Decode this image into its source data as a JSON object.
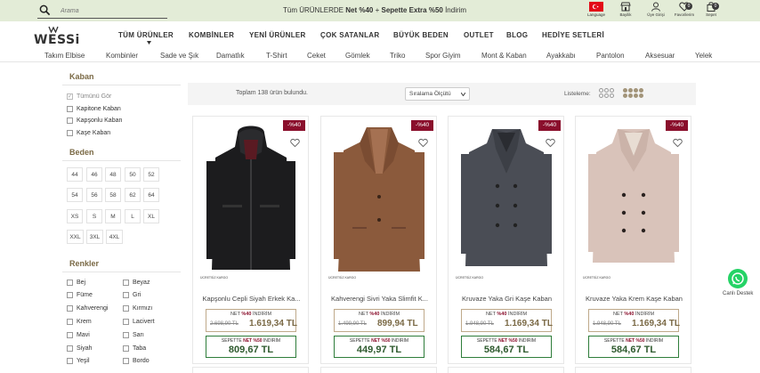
{
  "search": {
    "placeholder": "Arama"
  },
  "promo": {
    "prefix": "Tüm ÜRÜNLERDE ",
    "bold1": "Net %40",
    "middle": " + ",
    "bold2": "Sepette Extra %50",
    "suffix": " İndirim"
  },
  "utility": [
    {
      "label": "Language",
      "icon": "turkey-flag-icon"
    },
    {
      "label": "Bayilik",
      "icon": "store-icon"
    },
    {
      "label": "Üye Girişi",
      "icon": "user-icon"
    },
    {
      "label": "Favorilerim",
      "icon": "heart-icon",
      "badge": "0"
    },
    {
      "label": "Sepet",
      "icon": "bag-icon",
      "badge": "0"
    }
  ],
  "logo": {
    "text": "WESSi"
  },
  "main_nav": [
    "TÜM ÜRÜNLER",
    "KOMBİNLER",
    "YENİ ÜRÜNLER",
    "ÇOK SATANLAR",
    "BÜYÜK BEDEN",
    "OUTLET",
    "BLOG",
    "HEDİYE SETLERİ"
  ],
  "sub_nav": [
    "Takım Elbise",
    "Kombinler",
    "Sade ve Şık",
    "Damatlık",
    "T-Shirt",
    "Ceket",
    "Gömlek",
    "Triko",
    "Spor Giyim",
    "Mont & Kaban",
    "Ayakkabı",
    "Pantolon",
    "Aksesuar",
    "Yelek"
  ],
  "filters": {
    "kaban_title": "Kaban",
    "kaban": [
      "Tümünü Gör",
      "Kapitone Kaban",
      "Kapşonlu Kaban",
      "Kaşe Kaban"
    ],
    "beden_title": "Beden",
    "sizes": [
      "44",
      "46",
      "48",
      "50",
      "52",
      "54",
      "56",
      "58",
      "62",
      "64",
      "XS",
      "S",
      "M",
      "L",
      "XL",
      "XXL",
      "3XL",
      "4XL"
    ],
    "renk_title": "Renkler",
    "colors_left": [
      "Bej",
      "Füme",
      "Kahverengi",
      "Krem",
      "Mavi",
      "Siyah",
      "Yeşil"
    ],
    "colors_right": [
      "Beyaz",
      "Gri",
      "Kırmızı",
      "Lacivert",
      "Sarı",
      "Taba",
      "Bordo"
    ]
  },
  "toolbar": {
    "total": "Toplam 138 ürün bulundu.",
    "sort": "Sıralama Ölçütü",
    "list_label": "Listeleme:"
  },
  "products": [
    {
      "name": "Kapşonlu Cepli Siyah Erkek Ka...",
      "discount": "-%40",
      "shipping": "ÜCRETSİZ KARGO",
      "net_label": "NET",
      "net_pct": "%40",
      "net_suffix": "İNDİRİM",
      "old": "2.698,90 TL",
      "new": "1.619,34 TL",
      "cart_label": "SEPETTE",
      "cart_pct": "NET %50",
      "cart_suffix": "İNDİRİM",
      "final": "809,67 TL",
      "color": "#1c1c1e"
    },
    {
      "name": "Kahverengi Sivri Yaka Slimfit K...",
      "discount": "-%40",
      "shipping": "ÜCRETSİZ KARGO",
      "net_label": "NET",
      "net_pct": "%40",
      "net_suffix": "İNDİRİM",
      "old": "1.499,90 TL",
      "new": "899,94 TL",
      "cart_label": "SEPETTE",
      "cart_pct": "NET %50",
      "cart_suffix": "İNDİRİM",
      "final": "449,97 TL",
      "color": "#8b5a3c"
    },
    {
      "name": "Kruvaze Yaka Gri Kaşe Kaban",
      "discount": "-%40",
      "shipping": "ÜCRETSİZ KARGO",
      "net_label": "NET",
      "net_pct": "%40",
      "net_suffix": "İNDİRİM",
      "old": "1.948,90 TL",
      "new": "1.169,34 TL",
      "cart_label": "SEPETTE",
      "cart_pct": "NET %50",
      "cart_suffix": "İNDİRİM",
      "final": "584,67 TL",
      "color": "#4a4d55"
    },
    {
      "name": "Kruvaze Yaka Krem Kaşe Kaban",
      "discount": "-%40",
      "shipping": "ÜCRETSİZ KARGO",
      "net_label": "NET",
      "net_pct": "%40",
      "net_suffix": "İNDİRİM",
      "old": "1.948,90 TL",
      "new": "1.169,34 TL",
      "cart_label": "SEPETTE",
      "cart_pct": "NET %50",
      "cart_suffix": "İNDİRİM",
      "final": "584,67 TL",
      "color": "#d9c3ba"
    }
  ],
  "whatsapp": {
    "label": "Canlı Destek",
    "icon": "whatsapp-icon"
  },
  "colors": {
    "topbar": "#e3ecd7",
    "accent": "#7a6945",
    "discount": "#8a0f2c",
    "green": "#2e7d3a"
  }
}
